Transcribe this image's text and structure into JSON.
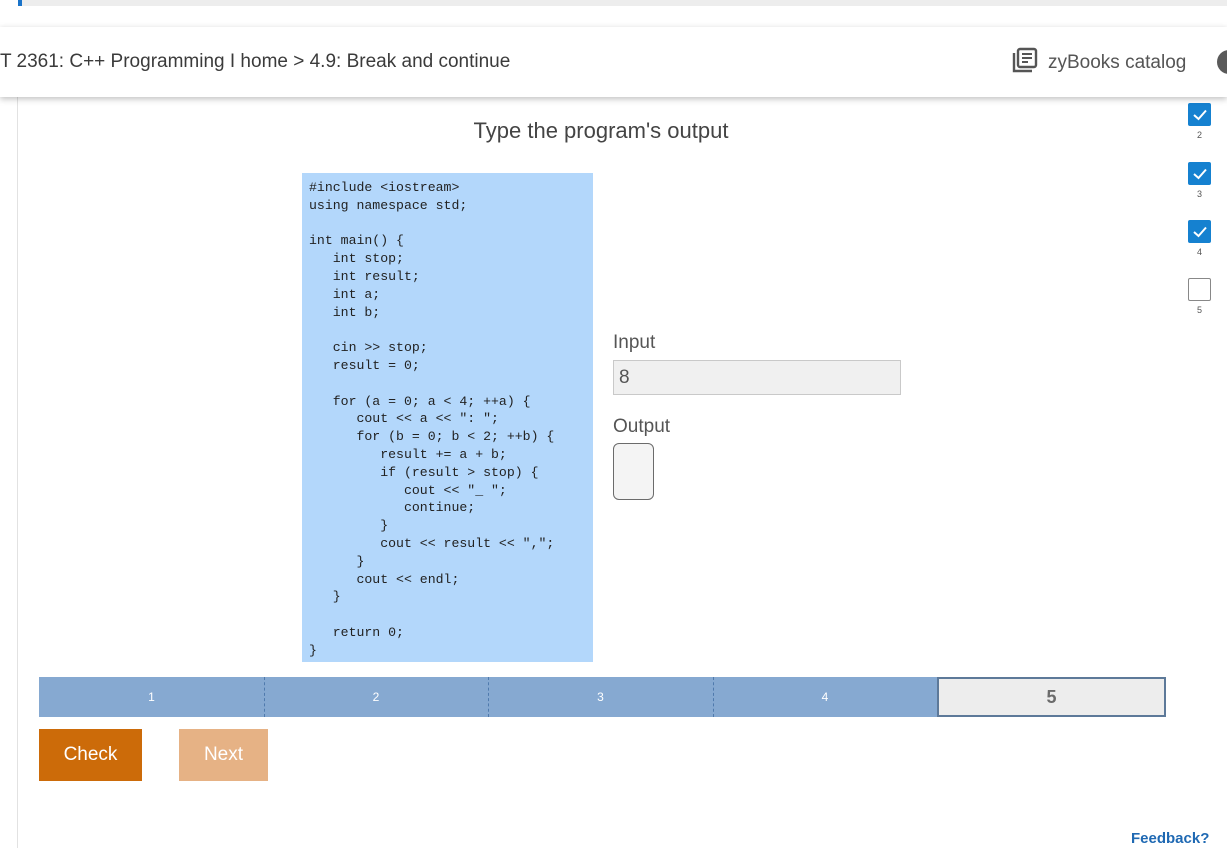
{
  "header": {
    "breadcrumb": "T 2361: C++ Programming I home > 4.9: Break and continue",
    "catalog_label": "zyBooks catalog"
  },
  "activity": {
    "title": "Type the program's output",
    "code_lines": [
      "#include <iostream>",
      "using namespace std;",
      "",
      "int main() {",
      "   int stop;",
      "   int result;",
      "   int a;",
      "   int b;",
      "",
      "   cin >> stop;",
      "   result = 0;",
      "",
      "   for (a = 0; a < 4; ++a) {",
      "      cout << a << \": \";",
      "      for (b = 0; b < 2; ++b) {",
      "         result += a + b;",
      "         if (result > stop) {",
      "            cout << \"_ \";",
      "            continue;",
      "         }",
      "         cout << result << \",\";",
      "      }",
      "      cout << endl;",
      "   }",
      "",
      "   return 0;",
      "}"
    ],
    "input_label": "Input",
    "input_value": "8",
    "output_label": "Output",
    "output_value": ""
  },
  "progress": {
    "segments": [
      "1",
      "2",
      "3",
      "4",
      "5"
    ],
    "current": "5"
  },
  "buttons": {
    "check": "Check",
    "next": "Next"
  },
  "levels": [
    {
      "label": "2",
      "done": true
    },
    {
      "label": "3",
      "done": true
    },
    {
      "label": "4",
      "done": true
    },
    {
      "label": "5",
      "done": false
    }
  ],
  "feedback": "Feedback?",
  "colors": {
    "code_bg": "#b3d7fb",
    "check_btn": "#cc6b09",
    "next_btn": "#e6b285",
    "progress_done": "#86a9d1",
    "level_done": "#1581d0"
  }
}
